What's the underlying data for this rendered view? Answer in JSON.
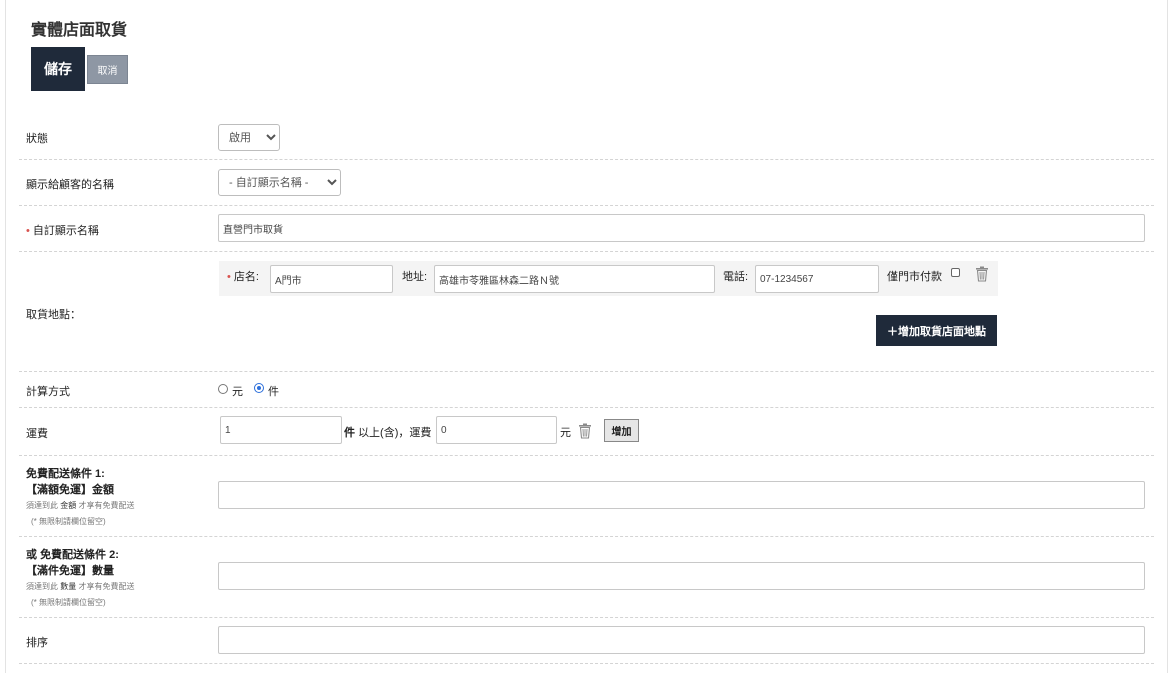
{
  "header": {
    "title": "實體店面取貨",
    "save_label": "儲存",
    "cancel_label": "取消"
  },
  "status": {
    "label": "狀態",
    "selected": "啟用"
  },
  "display_name": {
    "label": "顯示給顧客的名稱",
    "selected": "- 自訂顯示名稱 -"
  },
  "custom_name": {
    "required_mark": "•",
    "label": "自訂顯示名稱",
    "value": "直營門市取貨"
  },
  "pickup": {
    "label": "取貨地點：",
    "required_mark": "•",
    "store_label": "店名:",
    "store_value": "A門市",
    "address_label": "地址:",
    "address_value": "高雄市苓雅區林森二路Ｎ號",
    "phone_label": "電話:",
    "phone_value": "07-1234567",
    "store_pay_label": "僅門市付款",
    "store_pay_checked": false,
    "add_store_label": "＋增加取貨店面地點"
  },
  "calc": {
    "label": "計算方式",
    "option_yuan": "元",
    "option_item": "件",
    "selected": "件"
  },
  "shipping": {
    "label": "運費",
    "qty_value": "1",
    "qty_unit": "件",
    "middle_text": "以上(含)，運費",
    "fee_value": "0",
    "fee_unit": "元",
    "add_label": "增加"
  },
  "free1": {
    "title": "免費配送條件 1:",
    "subtitle": "【滿額免運】金額",
    "hint_prefix": "須達到此",
    "hint_keyword": "金額",
    "hint_suffix": "才享有免費配送",
    "note": "(* 無限制請欄位留空)",
    "value": ""
  },
  "free2": {
    "title_prefix": "或",
    "title": "免費配送條件 2:",
    "subtitle": "【滿件免運】數量",
    "hint_prefix": "須達到此",
    "hint_keyword": "數量",
    "hint_suffix": "才享有免費配送",
    "note": "(* 無限制請欄位留空)",
    "value": ""
  },
  "sort": {
    "label": "排序",
    "value": ""
  },
  "colors": {
    "primary": "#1f2a3a",
    "secondary": "#8e97a4",
    "required": "#d9534f"
  }
}
